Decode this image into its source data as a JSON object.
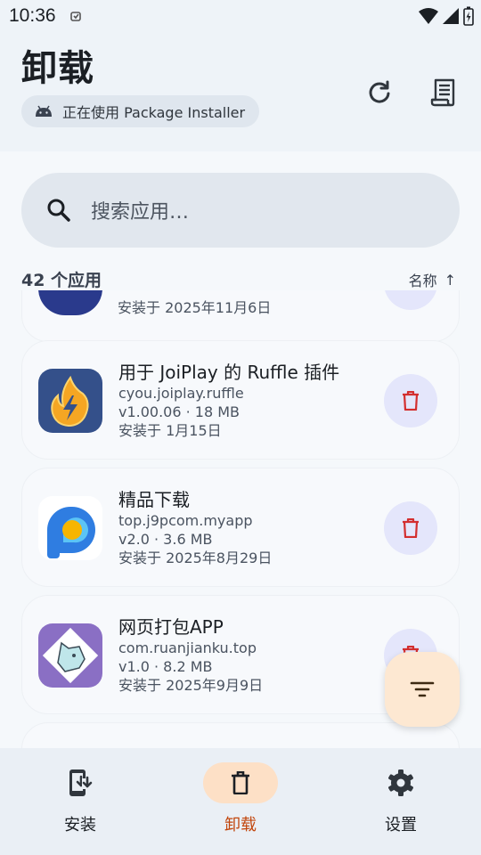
{
  "status_bar": {
    "time": "10:36"
  },
  "header": {
    "title": "卸载",
    "installer_chip": "正在使用 Package Installer",
    "refresh_icon": "refresh-icon",
    "log_icon": "receipt-icon"
  },
  "search": {
    "placeholder": "搜索应用…"
  },
  "list_header": {
    "count": "42 个应用",
    "sort_label": "名称",
    "sort_arrow": "↑"
  },
  "partial_top": {
    "date": "安装于 2025年11月6日"
  },
  "apps": [
    {
      "name": "用于 JoiPlay 的 Ruffle 插件",
      "package": "cyou.joiplay.ruffle",
      "version": "v1.00.06 · 18 MB",
      "date": "安装于 1月15日"
    },
    {
      "name": "精品下载",
      "package": "top.j9pcom.myapp",
      "version": "v2.0 · 3.6 MB",
      "date": "安装于 2025年8月29日"
    },
    {
      "name": "网页打包APP",
      "package": "com.ruanjianku.top",
      "version": "v1.0 · 8.2 MB",
      "date": "安装于 2025年9月9日"
    }
  ],
  "nav": {
    "install": "安装",
    "uninstall": "卸载",
    "settings": "设置"
  },
  "colors": {
    "accent": "#c2470e",
    "delete": "#d32f2f",
    "fab_bg": "#fde8d2"
  }
}
